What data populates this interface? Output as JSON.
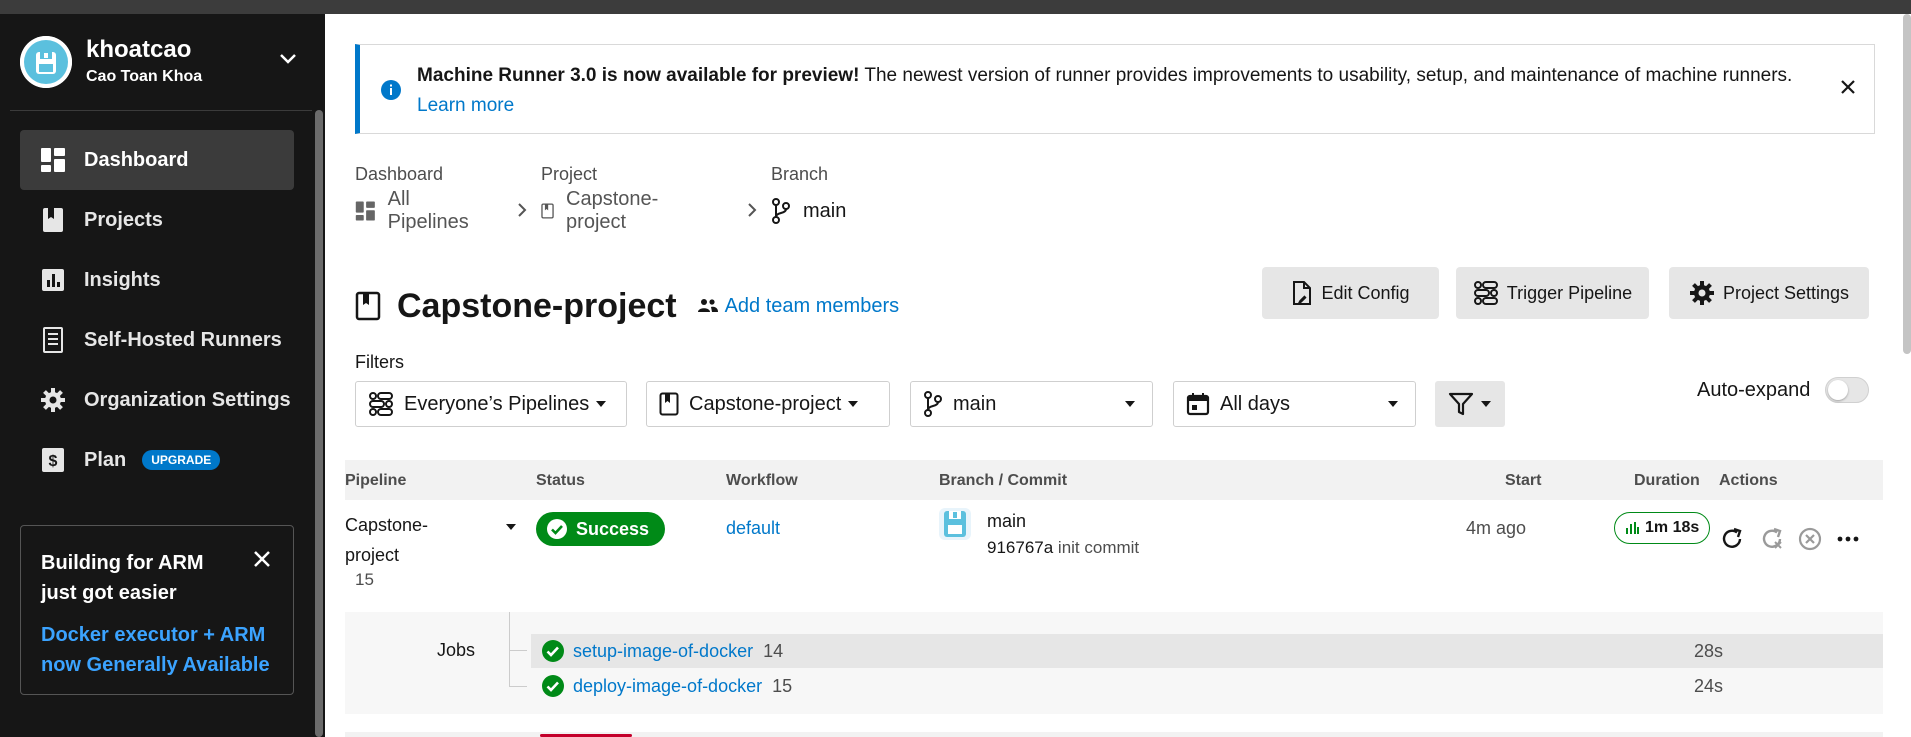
{
  "colors": {
    "accent": "#0078ca",
    "success": "#008a17",
    "sidebar_bg": "#161616"
  },
  "org": {
    "name": "khoatcao",
    "user": "Cao Toan Khoa"
  },
  "nav": {
    "items": [
      {
        "label": "Dashboard",
        "icon": "dashboard-icon",
        "active": true
      },
      {
        "label": "Projects",
        "icon": "projects-icon"
      },
      {
        "label": "Insights",
        "icon": "insights-icon"
      },
      {
        "label": "Self-Hosted Runners",
        "icon": "runners-icon"
      },
      {
        "label": "Organization Settings",
        "icon": "gear-icon"
      },
      {
        "label": "Plan",
        "icon": "plan-icon",
        "badge": "UPGRADE"
      }
    ]
  },
  "arm_card": {
    "title": "Building for ARM just got easier",
    "link": "Docker executor + ARM now Generally Available"
  },
  "banner": {
    "bold": "Machine Runner 3.0 is now available for preview!",
    "text": " The newest version of runner provides improvements to usability, setup, and maintenance of machine runners. ",
    "link": "Learn more"
  },
  "breadcrumb": {
    "dashboard_label": "Dashboard",
    "dashboard_value": "All Pipelines",
    "project_label": "Project",
    "project_value": "Capstone-project",
    "branch_label": "Branch",
    "branch_value": "main"
  },
  "project": {
    "title": "Capstone-project",
    "add_team": "Add team members"
  },
  "header_buttons": {
    "edit_config": "Edit Config",
    "trigger_pipeline": "Trigger Pipeline",
    "project_settings": "Project Settings"
  },
  "filters": {
    "label": "Filters",
    "pipelines": "Everyone’s Pipelines",
    "project": "Capstone-project",
    "branch": "main",
    "days": "All days",
    "auto_expand": "Auto-expand",
    "auto_expand_on": false
  },
  "table": {
    "headers": {
      "pipeline": "Pipeline",
      "status": "Status",
      "workflow": "Workflow",
      "branch_commit": "Branch / Commit",
      "start": "Start",
      "duration": "Duration",
      "actions": "Actions"
    },
    "row": {
      "pipeline_name": "Capstone-project",
      "pipeline_number": "15",
      "status": "Success",
      "workflow": "default",
      "branch": "main",
      "commit_sha": "916767a",
      "commit_msg": "init commit",
      "start": "4m ago",
      "duration": "1m 18s"
    },
    "jobs_label": "Jobs",
    "jobs": [
      {
        "name": "setup-image-of-docker",
        "number": "14",
        "duration": "28s"
      },
      {
        "name": "deploy-image-of-docker",
        "number": "15",
        "duration": "24s"
      }
    ]
  }
}
